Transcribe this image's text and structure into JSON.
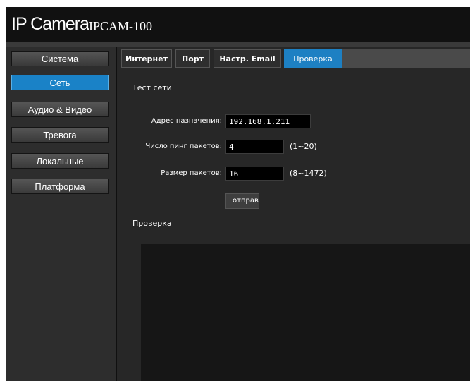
{
  "header": {
    "brand": "IP Camera",
    "model": "IPCAM-100"
  },
  "sidebar": {
    "items": [
      {
        "label": "Система",
        "active": false
      },
      {
        "label": "Сеть",
        "active": true
      },
      {
        "label": "Аудио & Видео",
        "active": false
      },
      {
        "label": "Тревога",
        "active": false
      },
      {
        "label": "Локальные",
        "active": false
      },
      {
        "label": "Платформа",
        "active": false
      }
    ]
  },
  "tabs": [
    {
      "label": "Интернет",
      "active": false
    },
    {
      "label": "Порт",
      "active": false
    },
    {
      "label": "Настр. Email",
      "active": false
    },
    {
      "label": "Проверка",
      "active": true
    }
  ],
  "network_test": {
    "title": "Тест сети",
    "destination": {
      "label": "Адрес назначения:",
      "value": "192.168.1.211"
    },
    "ping_count": {
      "label": "Число пинг пакетов:",
      "value": "4",
      "hint": "(1~20)"
    },
    "packet_size": {
      "label": "Размер пакетов:",
      "value": "16",
      "hint": "(8~1472)"
    },
    "send_label": "отправить"
  },
  "result": {
    "title": "Проверка"
  },
  "colors": {
    "accent": "#1a82c7",
    "background": "#1e1e1e",
    "panel": "#272727"
  }
}
